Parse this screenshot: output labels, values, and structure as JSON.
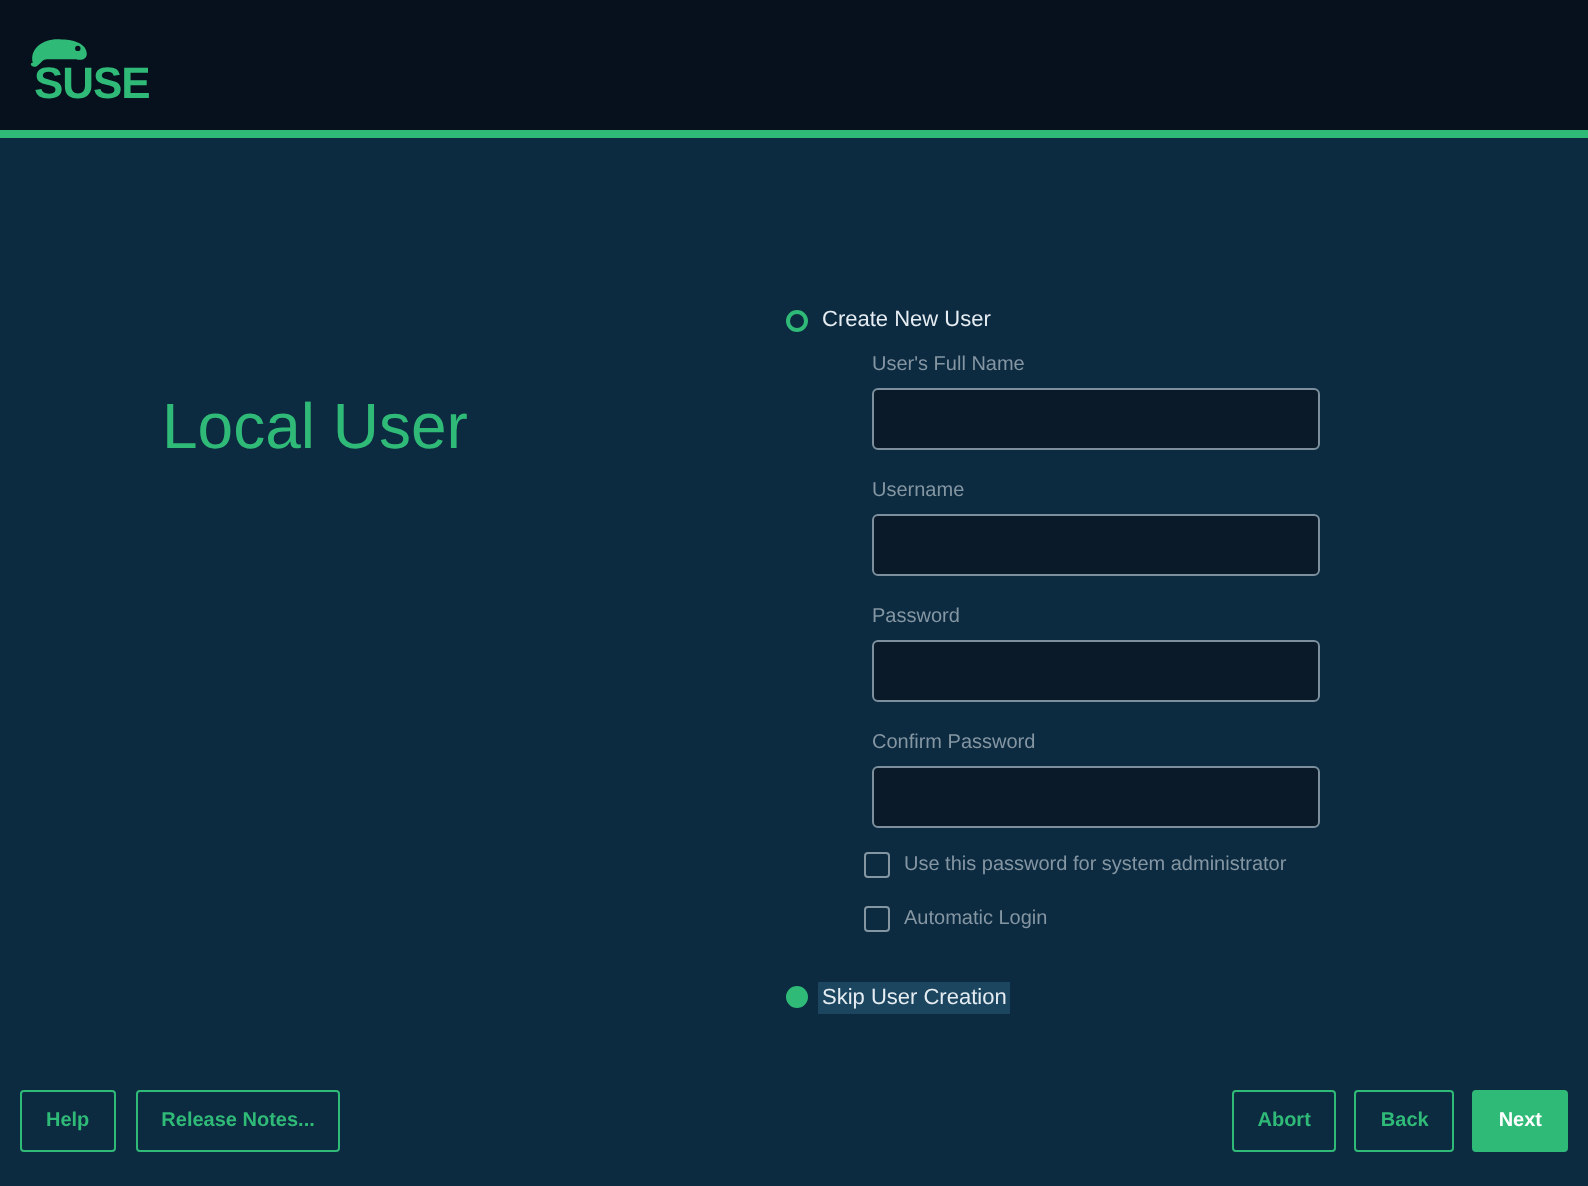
{
  "header": {
    "logo_text": "SUSE"
  },
  "title": "Local User",
  "options": [
    {
      "label": "Create New User",
      "selected": false
    },
    {
      "label": "Skip User Creation",
      "selected": true
    }
  ],
  "fields": [
    {
      "label": "User's Full Name",
      "disabled": true
    },
    {
      "label": "Username",
      "disabled": true
    },
    {
      "label": "Password",
      "disabled": true
    },
    {
      "label": "Confirm Password",
      "disabled": true
    }
  ],
  "checkboxes": [
    {
      "label": "Use this password for system administrator",
      "checked": false,
      "disabled": true
    },
    {
      "label": "Automatic Login",
      "checked": false,
      "disabled": true
    }
  ],
  "buttons_left": [
    {
      "label": "Help",
      "primary": false
    },
    {
      "label": "Release Notes...",
      "primary": false
    }
  ],
  "buttons_right": [
    {
      "label": "Abort",
      "primary": false
    },
    {
      "label": "Back",
      "primary": false
    },
    {
      "label": "Next",
      "primary": true
    }
  ]
}
